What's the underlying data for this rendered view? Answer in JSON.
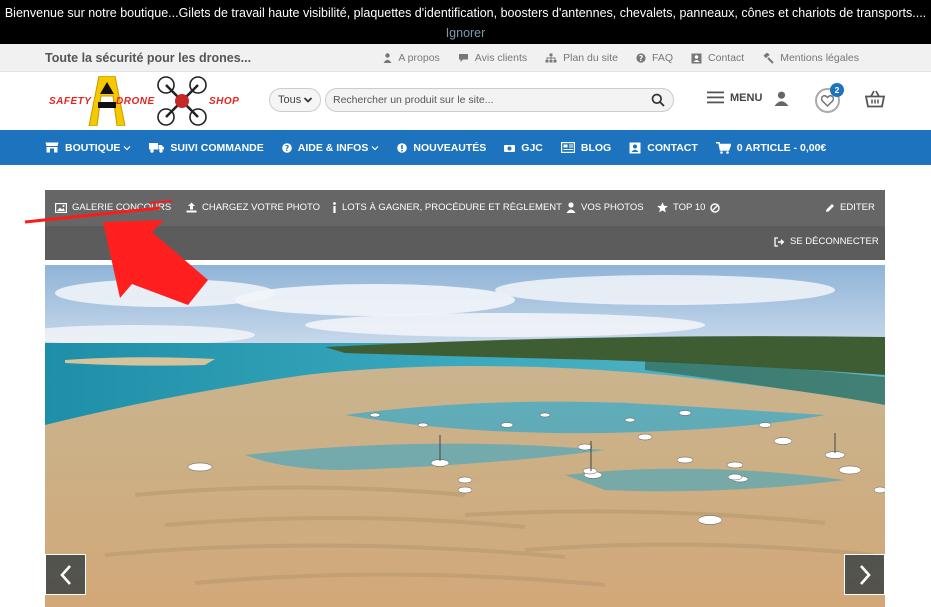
{
  "notice": {
    "message": "Bienvenue sur notre boutique...Gilets de travail haute visibilité, plaquettes d'identification, boosters d'antennes, chevalets, panneaux, cônes et chariots de transports....",
    "dismiss_label": "Ignorer"
  },
  "toplinks": {
    "tagline": "Toute la sécurité pour les drones...",
    "items": [
      {
        "label": "A propos",
        "icon": "person-icon"
      },
      {
        "label": "Avis clients",
        "icon": "comment-icon"
      },
      {
        "label": "Plan du site",
        "icon": "sitemap-icon"
      },
      {
        "label": "FAQ",
        "icon": "question-icon"
      },
      {
        "label": "Contact",
        "icon": "contact-card-icon"
      },
      {
        "label": "Mentions légales",
        "icon": "gavel-icon"
      }
    ]
  },
  "header": {
    "logo_words": [
      "SAFETY",
      "DRONE",
      "SHOP"
    ],
    "search_category": "Tous",
    "search_placeholder": "Rechercher un produit sur le site...",
    "menu_label": "MENU",
    "wishlist_count": "2"
  },
  "mainnav": {
    "items": [
      {
        "label": "BOUTIQUE",
        "icon": "shop-icon",
        "has_caret": true
      },
      {
        "label": "SUIVI COMMANDE",
        "icon": "truck-icon",
        "has_caret": false
      },
      {
        "label": "AIDE & INFOS",
        "icon": "question-icon",
        "has_caret": true
      },
      {
        "label": "NOUVEAUTÉS",
        "icon": "exclamation-icon",
        "has_caret": false
      },
      {
        "label": "GJC",
        "icon": "camera-icon",
        "has_caret": false
      },
      {
        "label": "BLOG",
        "icon": "newspaper-icon",
        "has_caret": false
      },
      {
        "label": "CONTACT",
        "icon": "contact-card-icon",
        "has_caret": false
      },
      {
        "label": "0 ARTICLE - 0,00€",
        "icon": "cart-icon",
        "has_caret": false
      }
    ]
  },
  "gallery_toolbar": {
    "galerie": "GALERIE CONCOURS",
    "upload": "CHARGEZ VOTRE PHOTO",
    "lots": "LOTS À GAGNER, PROCÉDURE ET RÈGLEMENT",
    "photos": "VOS PHOTOS",
    "top10": "TOP 10",
    "edit": "EDITER",
    "logout": "SE DÉCONNECTER"
  },
  "colors": {
    "nav_blue": "#1e73be",
    "annotation_red": "#ff0000",
    "toolbar_gray": "#666666"
  }
}
